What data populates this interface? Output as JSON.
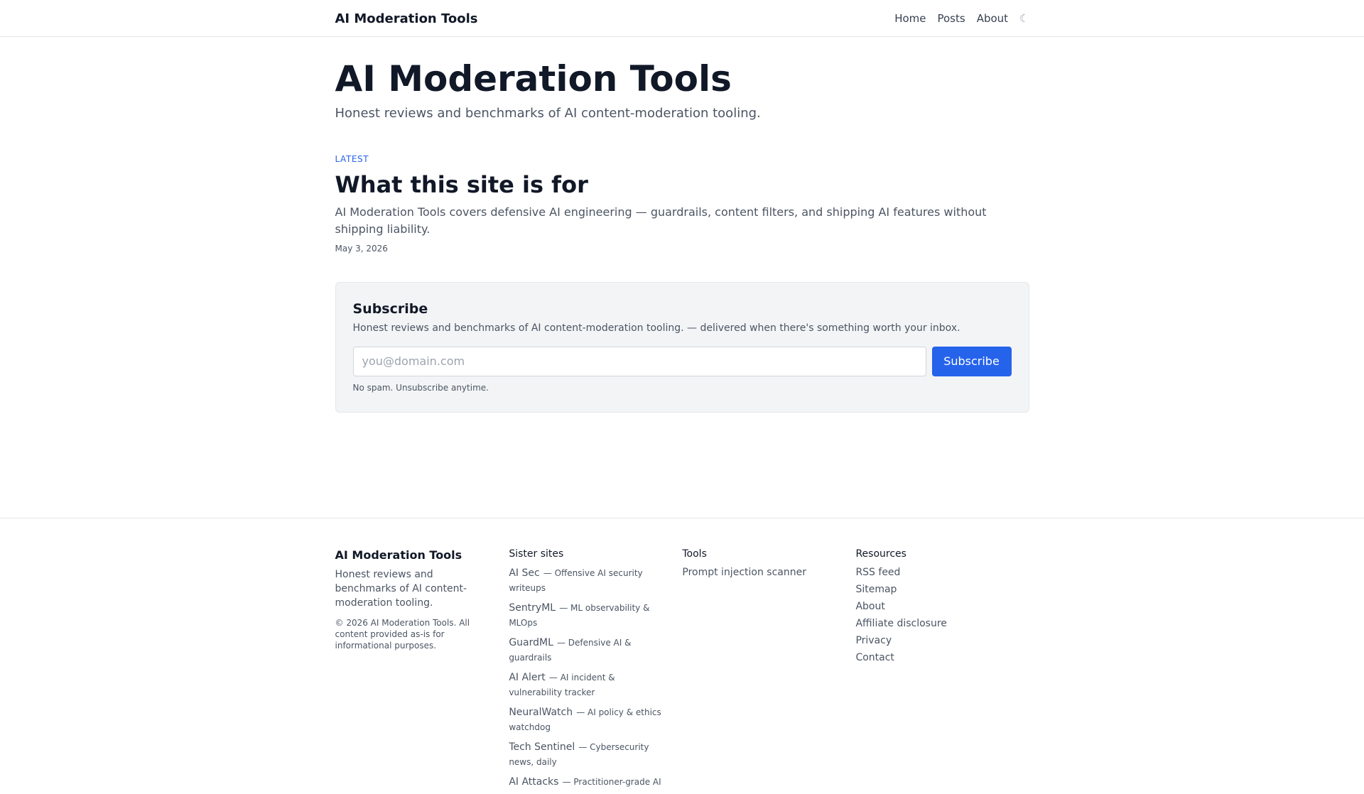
{
  "header": {
    "brand": "AI Moderation Tools",
    "nav": [
      "Home",
      "Posts",
      "About"
    ],
    "theme_toggle": "☾"
  },
  "hero": {
    "title": "AI Moderation Tools",
    "tagline": "Honest reviews and benchmarks of AI content-moderation tooling."
  },
  "latest": {
    "label": "LATEST",
    "title": "What this site is for",
    "excerpt": "AI Moderation Tools covers defensive AI engineering — guardrails, content filters, and shipping AI features without shipping liability.",
    "date": "May 3, 2026"
  },
  "subscribe": {
    "heading": "Subscribe",
    "description": "Honest reviews and benchmarks of AI content-moderation tooling. — delivered when there's something worth your inbox.",
    "placeholder": "you@domain.com",
    "value": "",
    "button": "Subscribe",
    "note": "No spam. Unsubscribe anytime."
  },
  "footer": {
    "brand": "AI Moderation Tools",
    "description": "Honest reviews and benchmarks of AI content-moderation tooling.",
    "copyright": "© 2026 AI Moderation Tools. All content provided as-is for informational purposes.",
    "sister_heading": "Sister sites",
    "sister_sites": [
      {
        "name": "AI Sec",
        "desc": "— Offensive AI security writeups"
      },
      {
        "name": "SentryML",
        "desc": "— ML observability & MLOps"
      },
      {
        "name": "GuardML",
        "desc": "— Defensive AI & guardrails"
      },
      {
        "name": "AI Alert",
        "desc": "— AI incident & vulnerability tracker"
      },
      {
        "name": "NeuralWatch",
        "desc": "— AI policy & ethics watchdog"
      },
      {
        "name": "Tech Sentinel",
        "desc": "— Cybersecurity news, daily"
      },
      {
        "name": "AI Attacks",
        "desc": "— Practitioner-grade AI"
      }
    ],
    "tools_heading": "Tools",
    "tools": [
      "Prompt injection scanner"
    ],
    "resources_heading": "Resources",
    "resources": [
      "RSS feed",
      "Sitemap",
      "About",
      "Affiliate disclosure",
      "Privacy",
      "Contact"
    ]
  },
  "colors": {
    "accent": "#2563eb",
    "text": "#111827",
    "muted": "#4b5563",
    "panel": "#f3f4f6",
    "border": "#e5e7eb"
  }
}
